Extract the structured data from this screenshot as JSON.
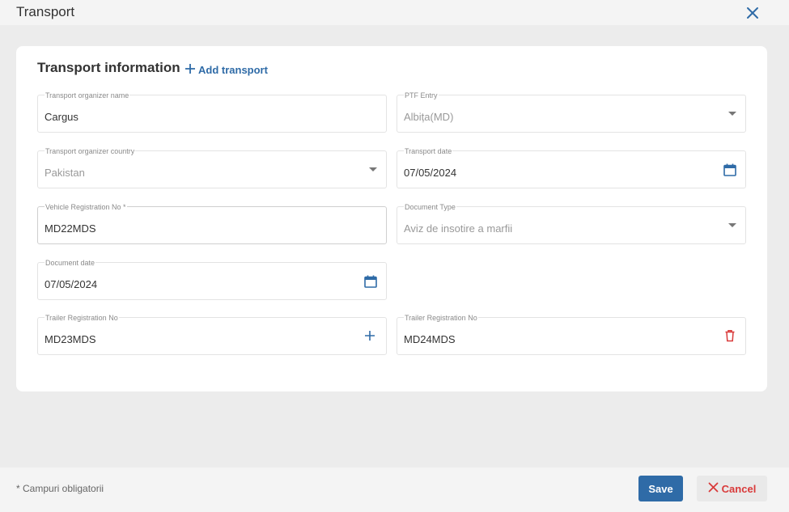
{
  "window": {
    "title": "Transport",
    "close_icon": "close-icon"
  },
  "section": {
    "title": "Transport information",
    "add_label": "Add transport"
  },
  "fields": {
    "organizer_name": {
      "label": "Transport organizer name",
      "value": "Cargus"
    },
    "ptf_entry": {
      "label": "PTF Entry",
      "value": "Albița(MD)"
    },
    "organizer_country": {
      "label": "Transport organizer country",
      "value": "Pakistan"
    },
    "transport_date": {
      "label": "Transport date",
      "value": "07/05/2024"
    },
    "vehicle_reg": {
      "label": "Vehicle Registration No *",
      "value": "MD22MDS"
    },
    "document_type": {
      "label": "Document Type",
      "value": "Aviz de insotire a marfii"
    },
    "document_date": {
      "label": "Document date",
      "value": "07/05/2024"
    },
    "trailer_reg_1": {
      "label": "Trailer Registration No",
      "value": "MD23MDS"
    },
    "trailer_reg_2": {
      "label": "Trailer Registration No",
      "value": "MD24MDS"
    }
  },
  "footer": {
    "note": "* Campuri obligatorii",
    "save_label": "Save",
    "cancel_label": "Cancel"
  },
  "colors": {
    "accent": "#2f6ba7",
    "danger": "#d93a3a",
    "background": "#ececec"
  }
}
